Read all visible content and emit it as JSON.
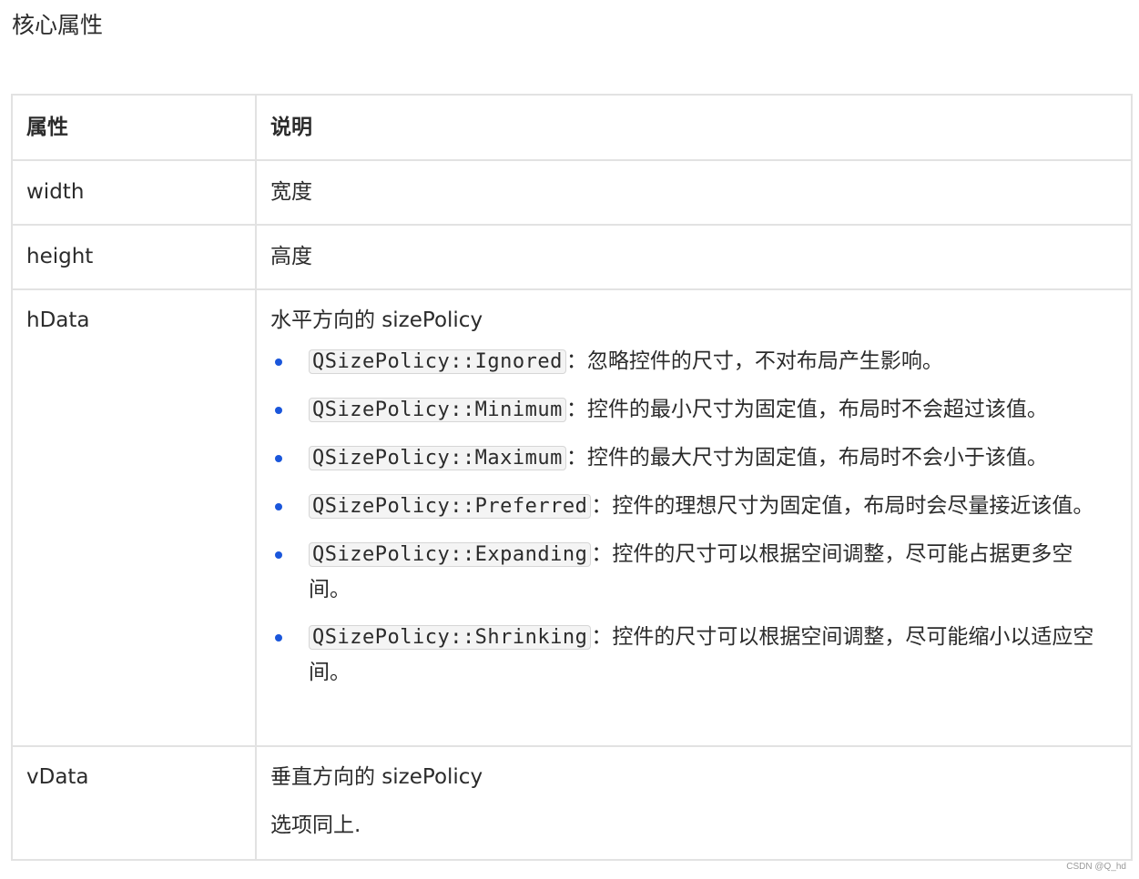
{
  "heading": "核心属性",
  "table": {
    "header": {
      "col1": "属性",
      "col2": "说明"
    },
    "rows": {
      "width": {
        "name": "width",
        "desc": "宽度"
      },
      "height": {
        "name": "height",
        "desc": "高度"
      },
      "hData": {
        "name": "hData",
        "desc": "水平方向的 sizePolicy",
        "options": [
          {
            "code": "QSizePolicy::Ignored",
            "text": "：忽略控件的尺寸，不对布局产生影响。"
          },
          {
            "code": "QSizePolicy::Minimum",
            "text": "：控件的最小尺寸为固定值，布局时不会超过该值。"
          },
          {
            "code": "QSizePolicy::Maximum",
            "text": "：控件的最大尺寸为固定值，布局时不会小于该值。"
          },
          {
            "code": "QSizePolicy::Preferred",
            "text": "：控件的理想尺寸为固定值，布局时会尽量接近该值。"
          },
          {
            "code": "QSizePolicy::Expanding",
            "text": "：控件的尺寸可以根据空间调整，尽可能占据更多空间。"
          },
          {
            "code": "QSizePolicy::Shrinking",
            "text": "：控件的尺寸可以根据空间调整，尽可能缩小以适应空间。"
          }
        ]
      },
      "vData": {
        "name": "vData",
        "desc": "垂直方向的 sizePolicy",
        "note": "选项同上."
      }
    }
  },
  "watermark": "CSDN @Q_hd",
  "colors": {
    "bullet": "#1a56db",
    "border": "#e2e2e2",
    "code_bg": "#f4f4f4"
  }
}
